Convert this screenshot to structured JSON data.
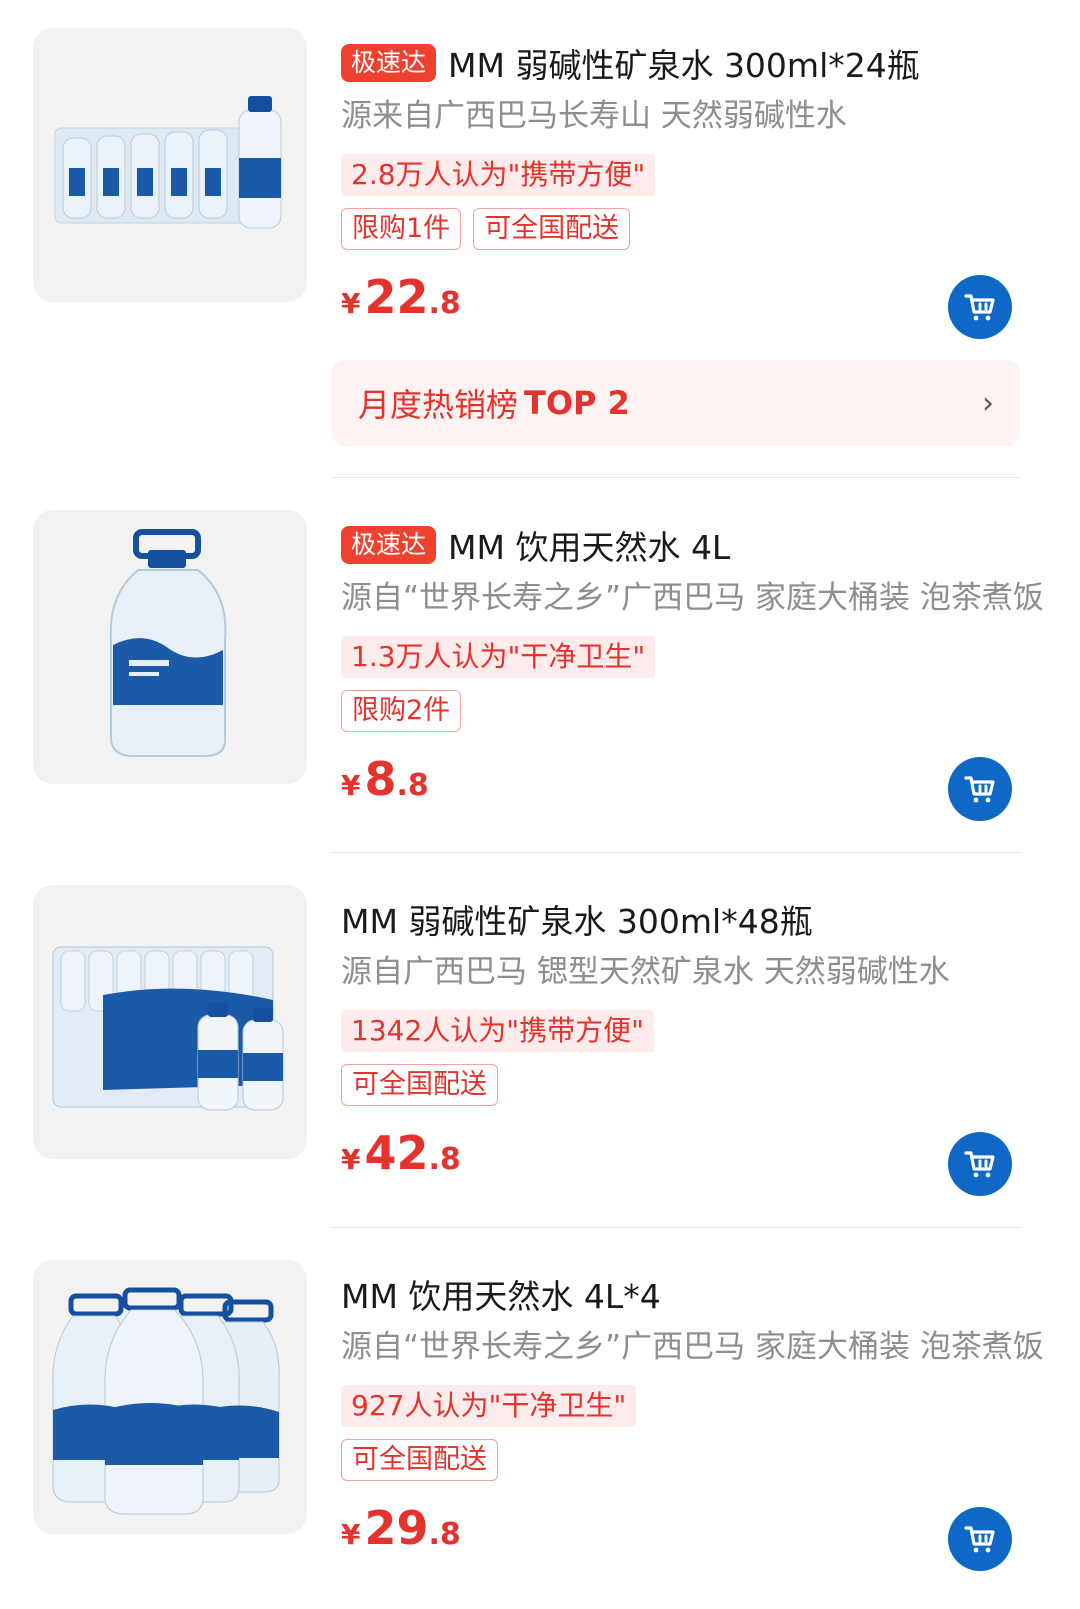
{
  "colors": {
    "accent_red": "#e5322d",
    "express_bg": "#ef4030",
    "cart_blue": "#1068c6"
  },
  "products": [
    {
      "express_badge": "极速达",
      "title": "MM 弱碱性矿泉水 300ml*24瓶",
      "subtitle": "源来自广西巴马长寿山 天然弱碱性水",
      "social_proof": "2.8万人认为\"携带方便\"",
      "tags": [
        "限购1件",
        "可全国配送"
      ],
      "price": {
        "currency": "¥",
        "integer": "22",
        "decimal": ".8"
      },
      "cart_icon": "shopping-cart-icon",
      "rank_banner": {
        "label": "月度热销榜",
        "top": "TOP 2",
        "arrow": "›"
      }
    },
    {
      "express_badge": "极速达",
      "title": "MM 饮用天然水 4L",
      "subtitle": "源自“世界长寿之乡”广西巴马  家庭大桶装 泡茶煮饭",
      "social_proof": "1.3万人认为\"干净卫生\"",
      "tags": [
        "限购2件"
      ],
      "price": {
        "currency": "¥",
        "integer": "8",
        "decimal": ".8"
      },
      "cart_icon": "shopping-cart-icon"
    },
    {
      "title": "MM 弱碱性矿泉水 300ml*48瓶",
      "subtitle": "源自广西巴马 锶型天然矿泉水 天然弱碱性水",
      "social_proof": "1342人认为\"携带方便\"",
      "tags": [
        "可全国配送"
      ],
      "price": {
        "currency": "¥",
        "integer": "42",
        "decimal": ".8"
      },
      "cart_icon": "shopping-cart-icon"
    },
    {
      "title": "MM 饮用天然水 4L*4",
      "subtitle": "源自“世界长寿之乡”广西巴马  家庭大桶装 泡茶煮饭",
      "social_proof": "927人认为\"干净卫生\"",
      "tags": [
        "可全国配送"
      ],
      "price": {
        "currency": "¥",
        "integer": "29",
        "decimal": ".8"
      },
      "cart_icon": "shopping-cart-icon"
    }
  ]
}
